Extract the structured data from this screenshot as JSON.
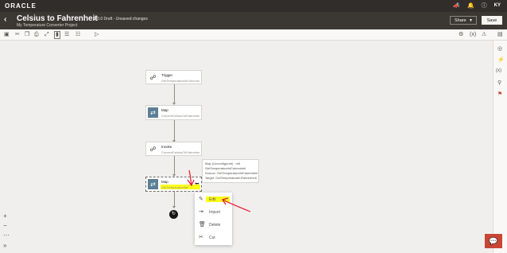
{
  "topbar": {
    "brand": "ORACLE",
    "icons": [
      "megaphone-icon",
      "bell-icon",
      "help-icon"
    ],
    "user_initials": "KY"
  },
  "header": {
    "title": "Celsius to Fahrenheit",
    "subtitle": "My Temperature Converter Project",
    "status": "1.0.0 Draft - Unsaved changes",
    "share_label": "Share",
    "save_label": "Save"
  },
  "nodes": {
    "trigger": {
      "title": "Trigger",
      "subtitle": "GetTemperatureInFahrenheit"
    },
    "map1": {
      "title": "Map",
      "subtitle": "ConvertCelsiusToFahrenheit"
    },
    "invoke": {
      "title": "Invoke",
      "subtitle": "ConvertCelsiusToFahrenheit"
    },
    "map2": {
      "title": "Map",
      "subtitle": "GetTemperatureInFahrenheit"
    }
  },
  "tooltip": {
    "line1": "Map (Unconfigured) : m5",
    "line2": "GetTemperatureInFahrenheit",
    "line3": "Source: GetTemperatureInFahrenheit",
    "line4": "Target: GetTemperatureInFahrenheit"
  },
  "context_menu": {
    "items": [
      {
        "label": "Edit",
        "icon": "pencil-icon"
      },
      {
        "label": "Import",
        "icon": "import-icon"
      },
      {
        "label": "Delete",
        "icon": "trash-icon"
      },
      {
        "label": "Cut",
        "icon": "scissors-icon"
      }
    ]
  },
  "colors": {
    "topbar": "#312d2a",
    "header": "#3b3834",
    "canvas": "#f1efed",
    "map_icon": "#5b7f95",
    "highlight": "#ffff00",
    "annotation": "#e8102a",
    "chat": "#c74634"
  }
}
